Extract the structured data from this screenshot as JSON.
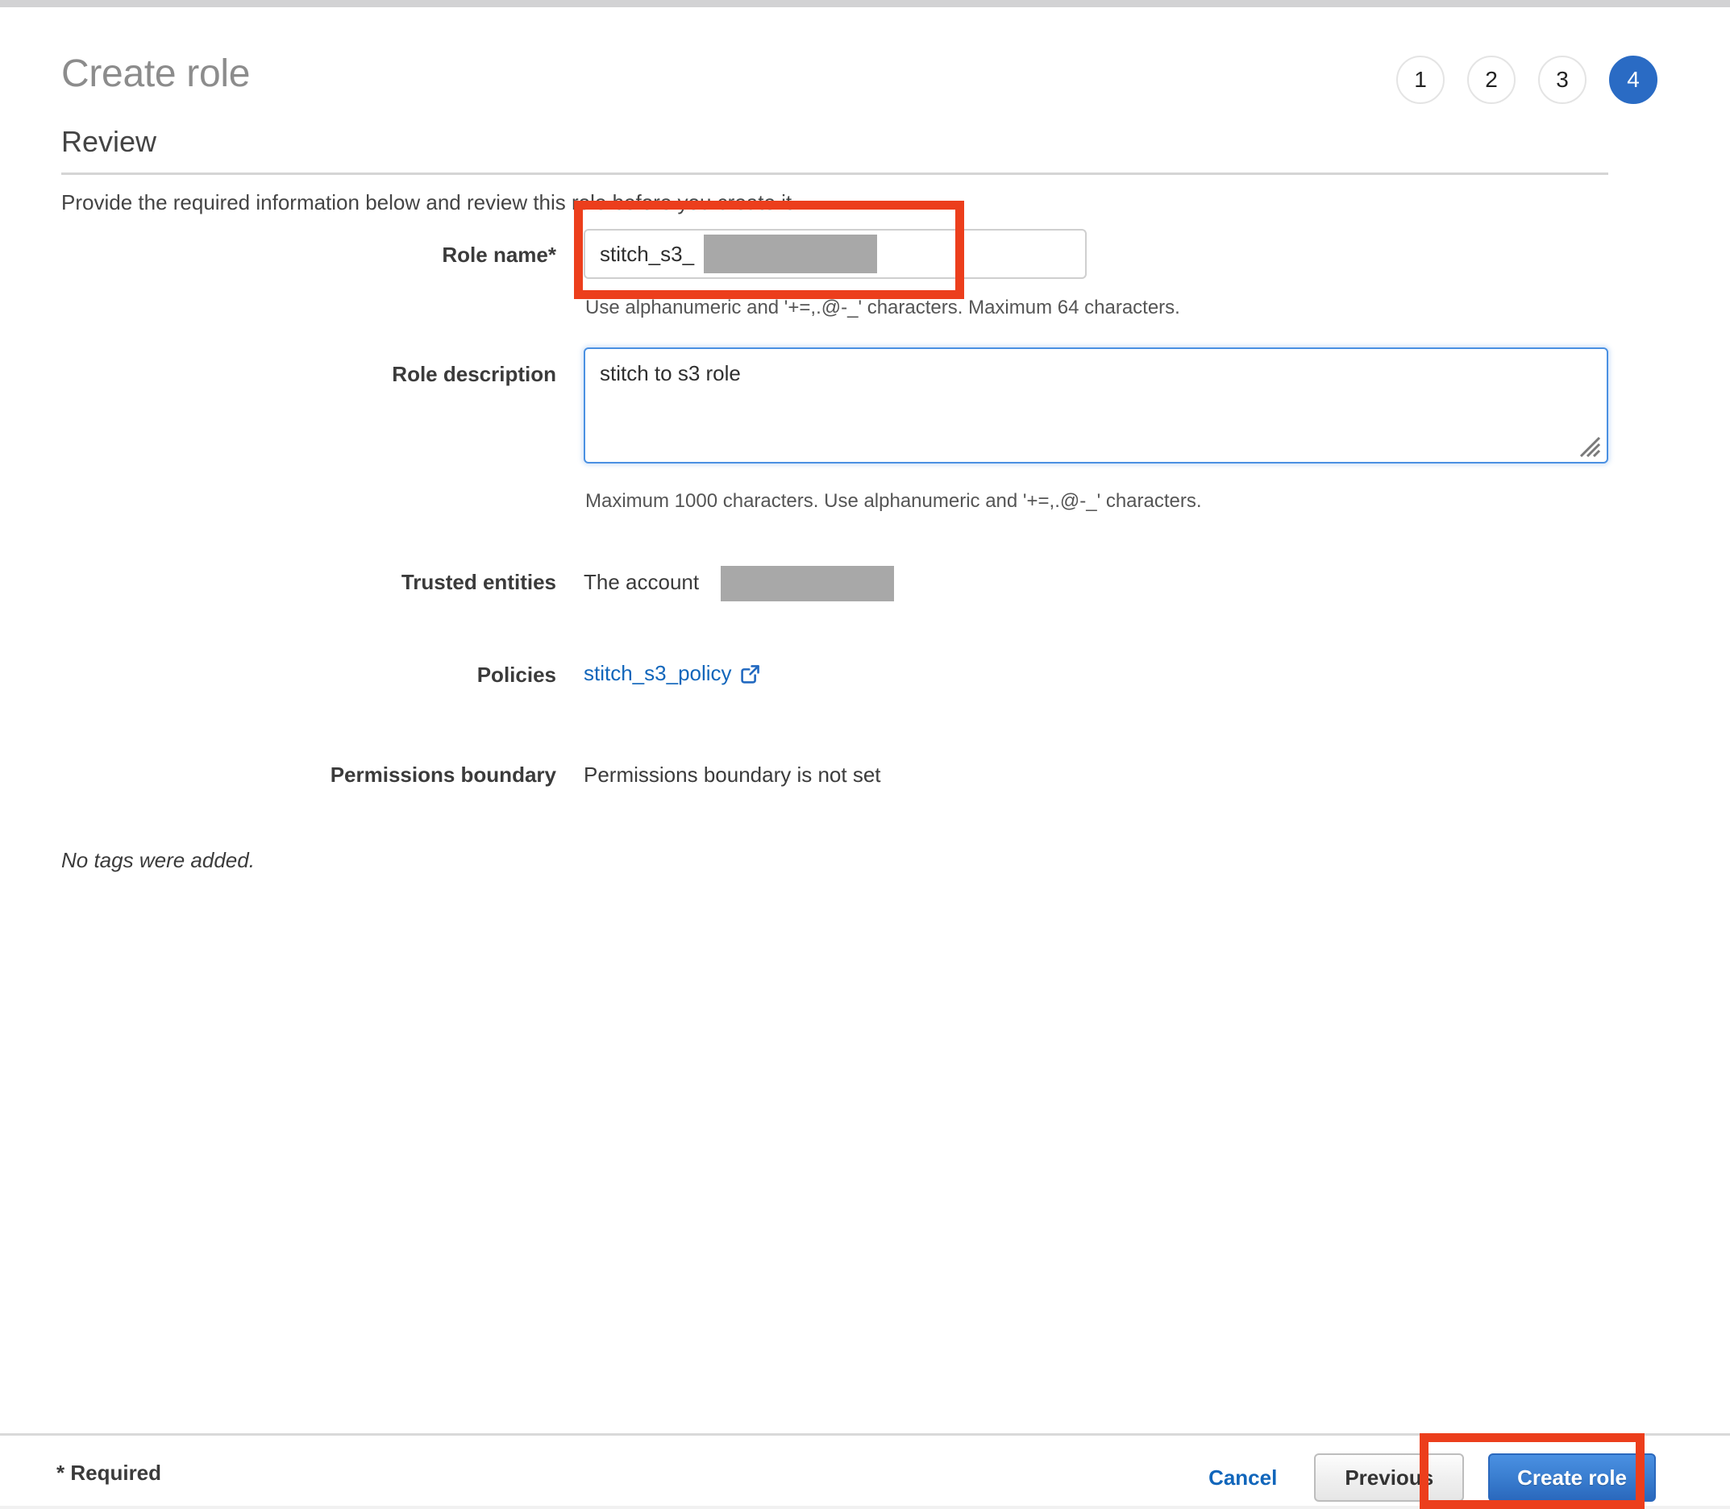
{
  "window": {
    "title": "Create role"
  },
  "steps": [
    {
      "label": "1",
      "active": false
    },
    {
      "label": "2",
      "active": false
    },
    {
      "label": "3",
      "active": false
    },
    {
      "label": "4",
      "active": true
    }
  ],
  "section": {
    "heading": "Review",
    "intro": "Provide the required information below and review this role before you create it."
  },
  "form": {
    "role_name": {
      "label": "Role name*",
      "value": "stitch_s3_",
      "placeholder": "",
      "hint": "Use alphanumeric and '+=,.@-_' characters. Maximum 64 characters."
    },
    "role_description": {
      "label": "Role description",
      "value": "stitch to s3 role",
      "placeholder": "",
      "hint": "Maximum 1000 characters. Use alphanumeric and '+=,.@-_' characters."
    },
    "trusted_entities": {
      "label": "Trusted entities",
      "value": "The account"
    },
    "policies": {
      "label": "Policies",
      "link_text": "stitch_s3_policy",
      "link_icon": "external-link-icon"
    },
    "permissions_boundary": {
      "label": "Permissions boundary",
      "value": "Permissions boundary is not set"
    },
    "tags": {
      "empty_text": "No tags were added."
    }
  },
  "footer": {
    "required_note": "* Required",
    "cancel_label": "Cancel",
    "previous_label": "Previous",
    "create_label": "Create role"
  },
  "colors": {
    "accent_blue": "#2a6bc4",
    "link_blue": "#1166bb",
    "annotation_red": "#ec3e1c",
    "redaction_gray": "#a8a8a8",
    "focus_blue": "#4a90e2"
  }
}
